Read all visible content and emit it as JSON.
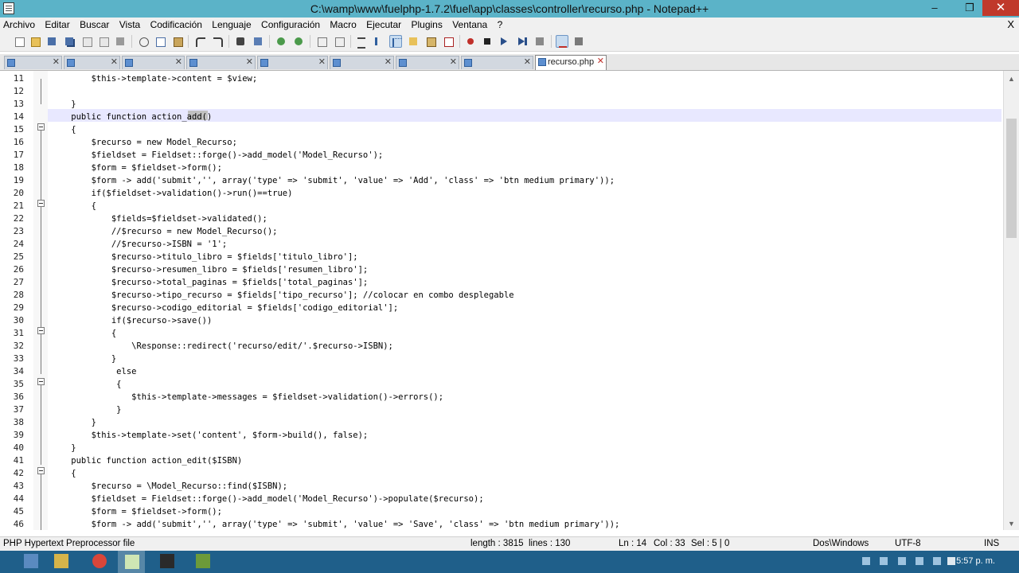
{
  "window": {
    "title": "C:\\wamp\\www\\fuelphp-1.7.2\\fuel\\app\\classes\\controller\\recurso.php - Notepad++",
    "min": "–",
    "max": "❐",
    "close": "✕"
  },
  "menu": [
    "Archivo",
    "Editar",
    "Buscar",
    "Vista",
    "Codificación",
    "Lenguaje",
    "Configuración",
    "Macro",
    "Ejecutar",
    "Plugins",
    "Ventana",
    "?"
  ],
  "menu_close": "X",
  "tabs": {
    "active_label": "recurso.php",
    "close": "✕"
  },
  "editor": {
    "lines": [
      {
        "n": "11",
        "code": "        $this->template->content = $view;"
      },
      {
        "n": "12",
        "code": ""
      },
      {
        "n": "13",
        "code": "    }"
      },
      {
        "n": "14",
        "code": "    public function action_add()"
      },
      {
        "n": "15",
        "code": "    {"
      },
      {
        "n": "16",
        "code": "        $recurso = new Model_Recurso;"
      },
      {
        "n": "17",
        "code": "        $fieldset = Fieldset::forge()->add_model('Model_Recurso');"
      },
      {
        "n": "18",
        "code": "        $form = $fieldset->form();"
      },
      {
        "n": "19",
        "code": "        $form -> add('submit','', array('type' => 'submit', 'value' => 'Add', 'class' => 'btn medium primary'));"
      },
      {
        "n": "20",
        "code": "        if($fieldset->validation()->run()==true)"
      },
      {
        "n": "21",
        "code": "        {"
      },
      {
        "n": "22",
        "code": "            $fields=$fieldset->validated();"
      },
      {
        "n": "23",
        "code": "            //$recurso = new Model_Recurso();"
      },
      {
        "n": "24",
        "code": "            //$recurso->ISBN = '1';"
      },
      {
        "n": "25",
        "code": "            $recurso->titulo_libro = $fields['titulo_libro'];"
      },
      {
        "n": "26",
        "code": "            $recurso->resumen_libro = $fields['resumen_libro'];"
      },
      {
        "n": "27",
        "code": "            $recurso->total_paginas = $fields['total_paginas'];"
      },
      {
        "n": "28",
        "code": "            $recurso->tipo_recurso = $fields['tipo_recurso']; //colocar en combo desplegable"
      },
      {
        "n": "29",
        "code": "            $recurso->codigo_editorial = $fields['codigo_editorial'];"
      },
      {
        "n": "30",
        "code": "            if($recurso->save())"
      },
      {
        "n": "31",
        "code": "            {"
      },
      {
        "n": "32",
        "code": "                \\Response::redirect('recurso/edit/'.$recurso->ISBN);"
      },
      {
        "n": "33",
        "code": "            }"
      },
      {
        "n": "34",
        "code": "             else"
      },
      {
        "n": "35",
        "code": "             {"
      },
      {
        "n": "36",
        "code": "                $this->template->messages = $fieldset->validation()->errors();"
      },
      {
        "n": "37",
        "code": "             }"
      },
      {
        "n": "38",
        "code": "        }"
      },
      {
        "n": "39",
        "code": "        $this->template->set('content', $form->build(), false);"
      },
      {
        "n": "40",
        "code": "    }"
      },
      {
        "n": "41",
        "code": "    public function action_edit($ISBN)"
      },
      {
        "n": "42",
        "code": "    {"
      },
      {
        "n": "43",
        "code": "        $recurso = \\Model_Recurso::find($ISBN);"
      },
      {
        "n": "44",
        "code": "        $fieldset = Fieldset::forge()->add_model('Model_Recurso')->populate($recurso);"
      },
      {
        "n": "45",
        "code": "        $form = $fieldset->form();"
      },
      {
        "n": "46",
        "code": "        $form -> add('submit','', array('type' => 'submit', 'value' => 'Save', 'class' => 'btn medium primary'));"
      }
    ]
  },
  "status": {
    "filetype": "PHP Hypertext Preprocessor file",
    "length": "length : 3815",
    "lines": "lines : 130",
    "ln": "Ln : 14",
    "col": "Col : 33",
    "sel": "Sel : 5 | 0",
    "eol": "Dos\\Windows",
    "encoding": "UTF-8",
    "mode": "INS"
  },
  "taskbar": {
    "clock": "5:57 p. m."
  },
  "colors": {
    "titlebar": "#5bb3c8",
    "taskbar": "#1f5f8a",
    "current_line": "#e8e8ff",
    "close": "#c0392b"
  },
  "icons": [
    "new-file-icon",
    "open-icon",
    "save-icon",
    "save-all-icon",
    "close-icon",
    "close-all-icon",
    "print-icon",
    "cut-icon",
    "copy-icon",
    "paste-icon",
    "undo-icon",
    "redo-icon",
    "find-icon",
    "replace-icon",
    "zoom-in-icon",
    "zoom-out-icon",
    "sync-v-icon",
    "sync-h-icon",
    "wrap-icon",
    "all-chars-icon",
    "indent-guide-icon",
    "folder-icon",
    "doc-map-icon",
    "function-list-icon",
    "record-icon",
    "stop-icon",
    "play-icon",
    "play-multi-icon",
    "save-macro-icon",
    "spellcheck-icon",
    "plugin-icon"
  ]
}
